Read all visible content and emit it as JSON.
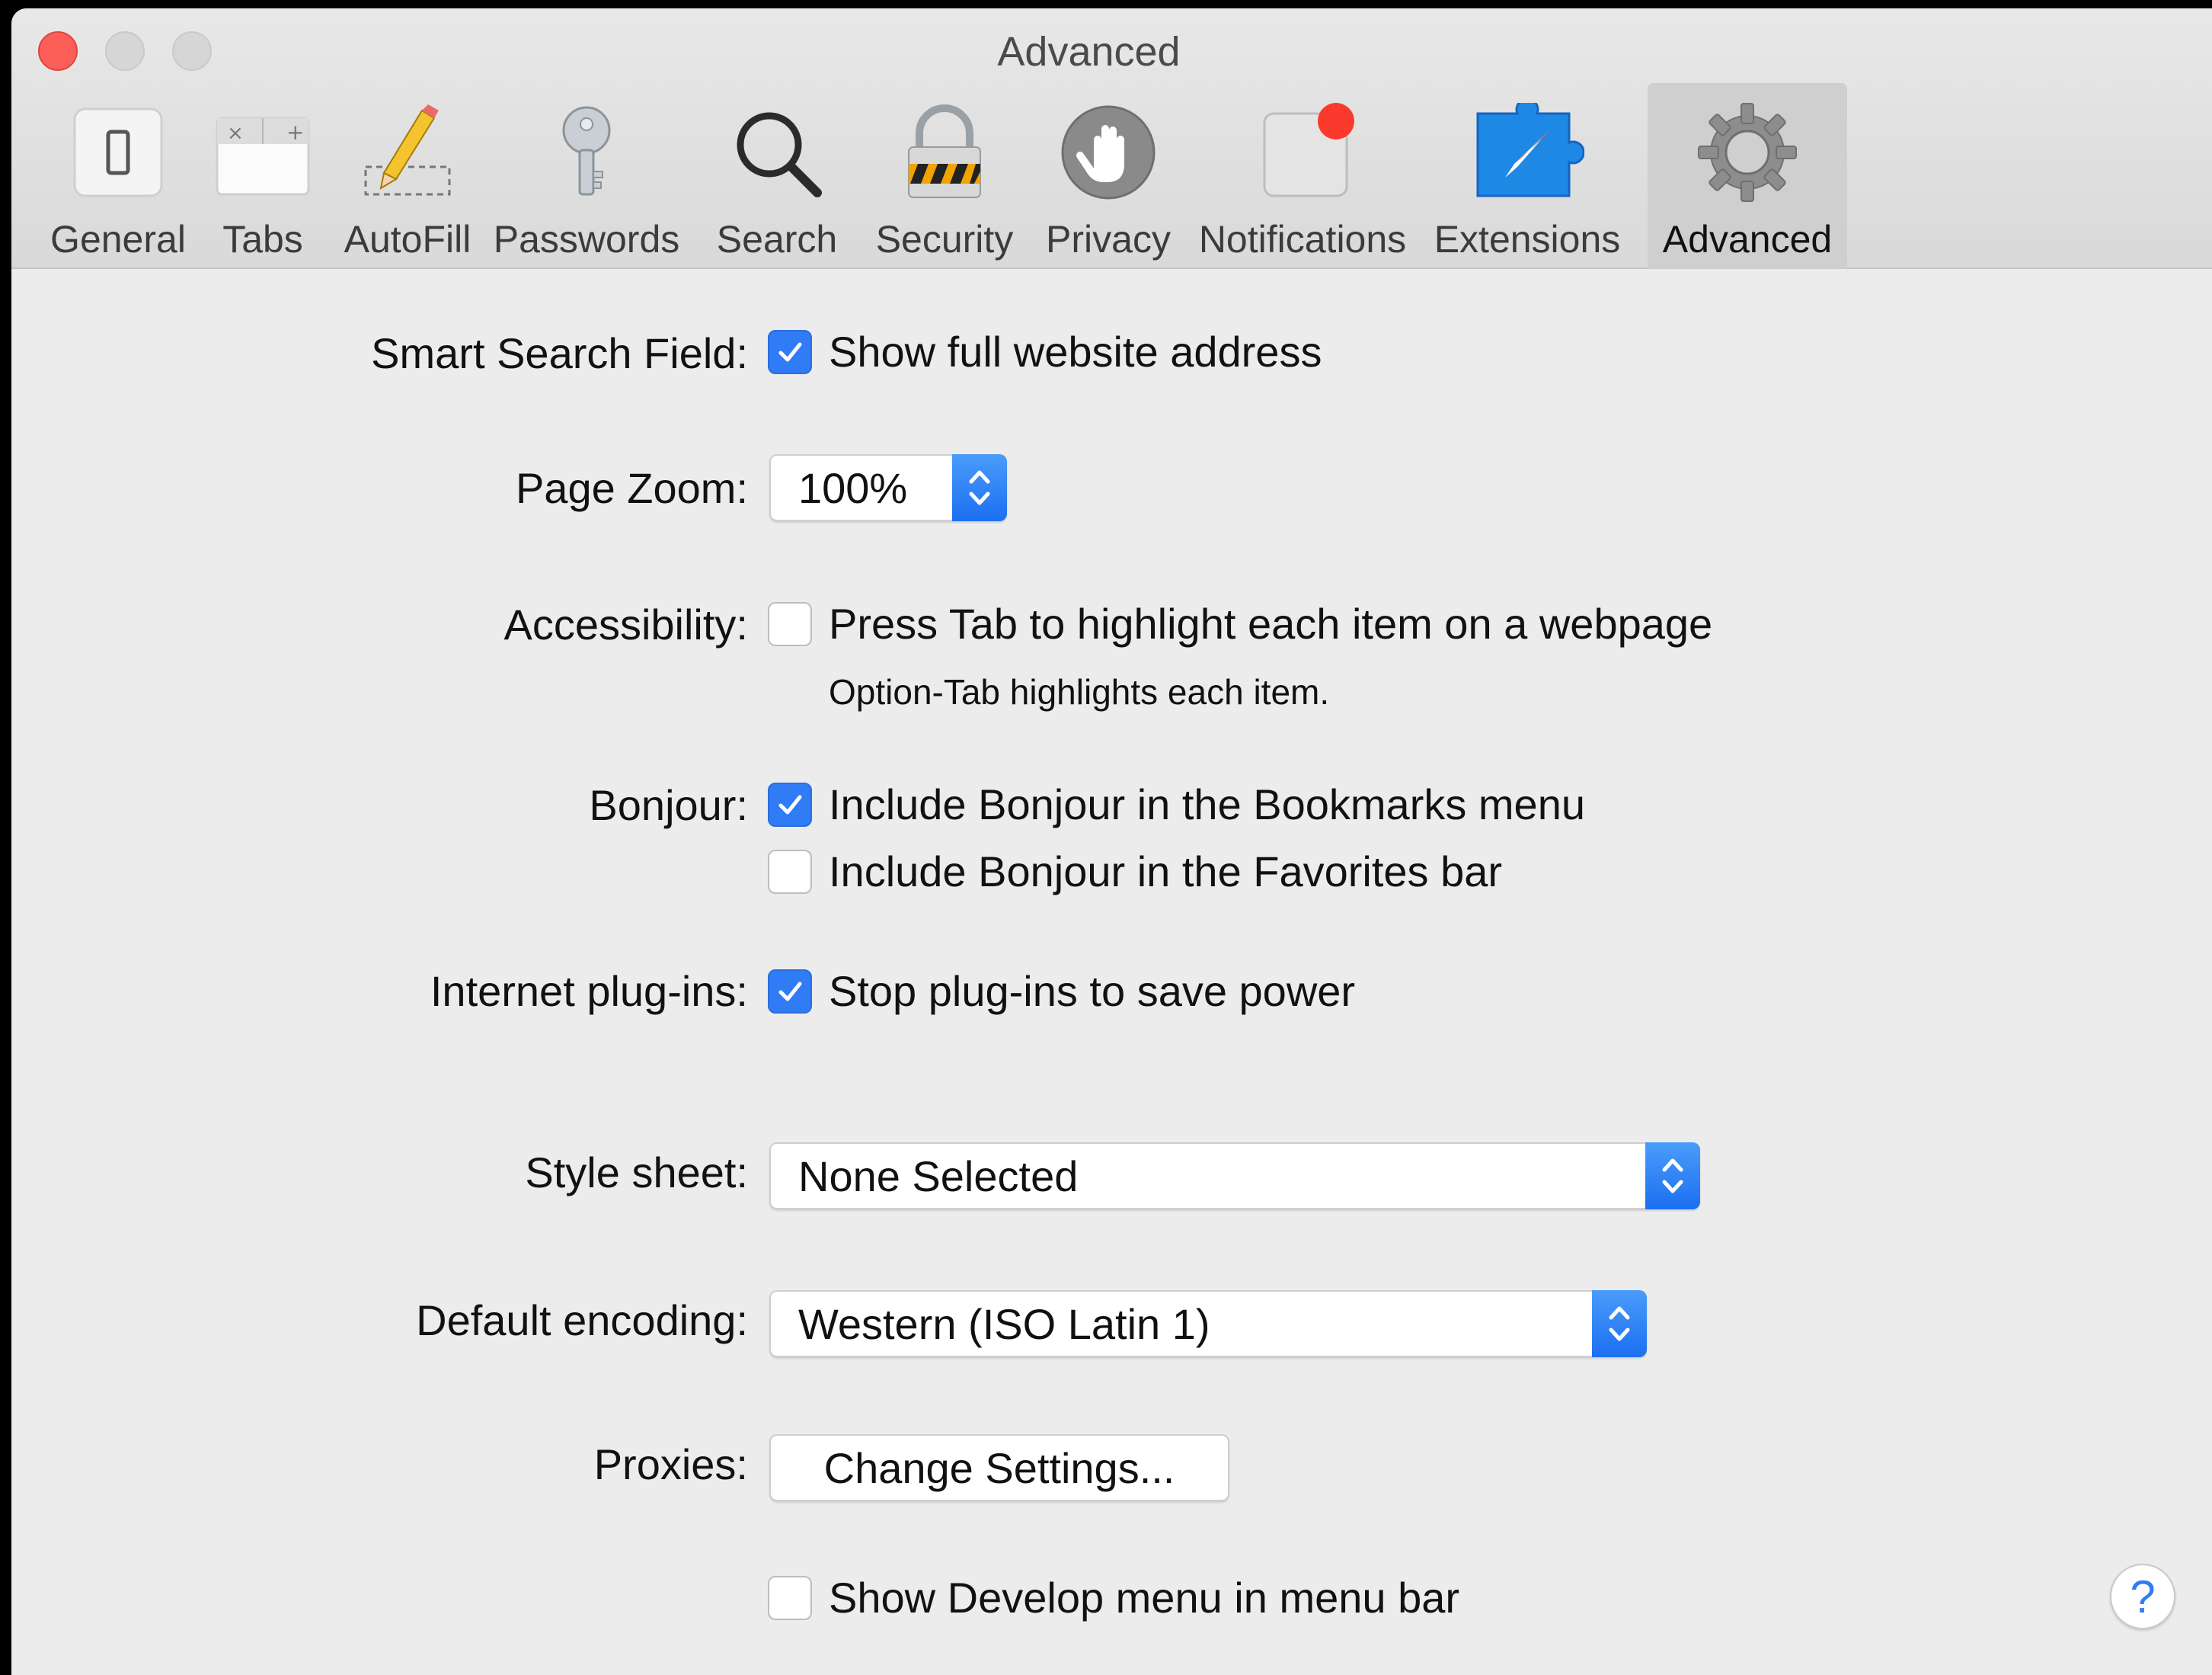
{
  "window": {
    "title": "Advanced"
  },
  "toolbar": {
    "tabs": [
      {
        "label": "General",
        "icon": "general-switch-icon"
      },
      {
        "label": "Tabs",
        "icon": "tabs-icon"
      },
      {
        "label": "AutoFill",
        "icon": "pencil-icon"
      },
      {
        "label": "Passwords",
        "icon": "key-icon"
      },
      {
        "label": "Search",
        "icon": "magnifier-icon"
      },
      {
        "label": "Security",
        "icon": "padlock-icon"
      },
      {
        "label": "Privacy",
        "icon": "hand-icon"
      },
      {
        "label": "Notifications",
        "icon": "notification-badge-icon"
      },
      {
        "label": "Extensions",
        "icon": "puzzle-compass-icon"
      },
      {
        "label": "Advanced",
        "icon": "gear-icon"
      }
    ],
    "selected": "Advanced"
  },
  "settings": {
    "smart_search": {
      "label": "Smart Search Field:",
      "option": "Show full website address",
      "checked": true
    },
    "page_zoom": {
      "label": "Page Zoom:",
      "value": "100%"
    },
    "accessibility": {
      "label": "Accessibility:",
      "option": "Press Tab to highlight each item on a webpage",
      "checked": false,
      "hint": "Option-Tab highlights each item."
    },
    "bonjour": {
      "label": "Bonjour:",
      "bookmarks_option": "Include Bonjour in the Bookmarks menu",
      "bookmarks_checked": true,
      "favorites_option": "Include Bonjour in the Favorites bar",
      "favorites_checked": false
    },
    "plugins": {
      "label": "Internet plug-ins:",
      "option": "Stop plug-ins to save power",
      "checked": true
    },
    "style_sheet": {
      "label": "Style sheet:",
      "value": "None Selected"
    },
    "encoding": {
      "label": "Default encoding:",
      "value": "Western (ISO Latin 1)"
    },
    "proxies": {
      "label": "Proxies:",
      "button": "Change Settings..."
    },
    "develop": {
      "option": "Show Develop menu in menu bar",
      "checked": false
    }
  },
  "help": {
    "label": "?"
  },
  "colors": {
    "accent": "#2f7cf6",
    "close": "#fc5f57",
    "background": "#ececec"
  }
}
